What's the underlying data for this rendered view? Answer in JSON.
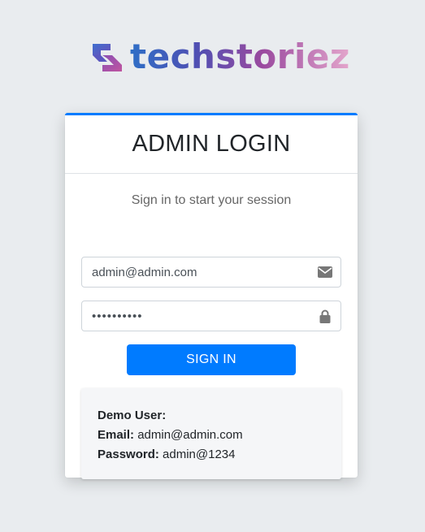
{
  "logo": {
    "text": "techstoriez",
    "icon": "techstoriez-logo-mark"
  },
  "card": {
    "title": "ADMIN LOGIN",
    "subtitle": "Sign in to start your session"
  },
  "form": {
    "email_value": "admin@admin.com",
    "email_icon": "envelope-icon",
    "password_value": "••••••••••",
    "password_icon": "lock-icon",
    "signin_label": "SIGN IN"
  },
  "demo": {
    "heading": "Demo User:",
    "email_label": "Email:",
    "email_value": "admin@admin.com",
    "password_label": "Password:",
    "password_value": "admin@1234"
  },
  "colors": {
    "accent": "#007bff",
    "background": "#e9ecef"
  }
}
